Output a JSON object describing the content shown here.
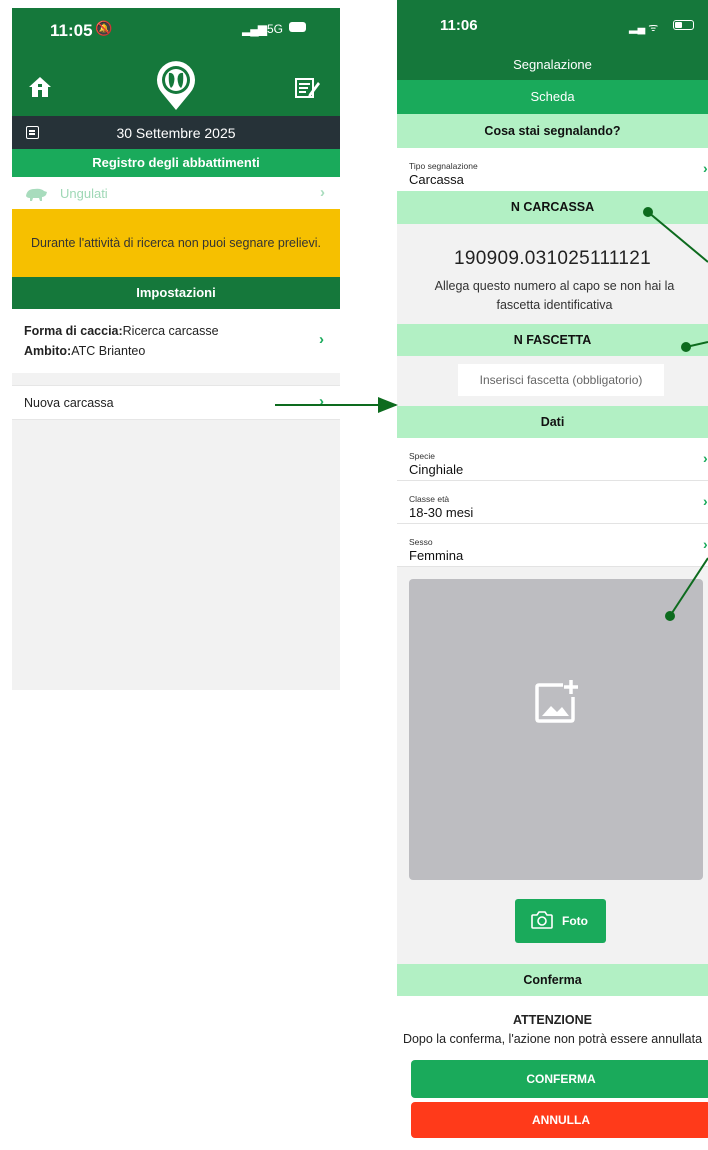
{
  "left": {
    "status": {
      "time": "11:05",
      "network": "5G"
    },
    "date": "30 Settembre 2025",
    "register_title": "Registro degli abbattimenti",
    "category": "Ungulati",
    "warning": "Durante l'attività di ricerca non puoi segnare prelievi.",
    "settings_title": "Impostazioni",
    "settings": {
      "hunt_form_label": "Forma di caccia:",
      "hunt_form_value": "Ricerca carcasse",
      "area_label": "Ambito:",
      "area_value": "ATC Brianteo"
    },
    "new_carcass": "Nuova carcassa"
  },
  "right": {
    "status": {
      "time": "11:06"
    },
    "header": "Segnalazione",
    "tab": "Scheda",
    "question": "Cosa stai segnalando?",
    "report_type": {
      "label": "Tipo segnalazione",
      "value": "Carcassa"
    },
    "carcass_title": "N CARCASSA",
    "carcass_number": "190909.031025111121",
    "carcass_hint": "Allega questo numero al capo se non hai la fascetta identificativa",
    "tag_title": "N FASCETTA",
    "tag_placeholder": "Inserisci fascetta (obbligatorio)",
    "data_title": "Dati",
    "fields": [
      {
        "label": "Specie",
        "value": "Cinghiale"
      },
      {
        "label": "Classe età",
        "value": "18-30 mesi"
      },
      {
        "label": "Sesso",
        "value": "Femmina"
      }
    ],
    "photo_button": "Foto",
    "confirm_title": "Conferma",
    "attention_title": "ATTENZIONE",
    "attention_text": "Dopo la conferma, l'azione non potrà essere annullata",
    "confirm_button": "CONFERMA",
    "cancel_button": "ANNULLA"
  },
  "colors": {
    "dark_green": "#15783b",
    "green": "#1aaa5b",
    "light_green": "#b2f0c4",
    "warning_yellow": "#f6c000",
    "cancel_red": "#ff3a1a",
    "date_bar": "#263238"
  },
  "icons": [
    "home-icon",
    "app-logo",
    "register-icon",
    "calendar-icon",
    "boar-icon",
    "add-photo-icon",
    "camera-icon"
  ]
}
